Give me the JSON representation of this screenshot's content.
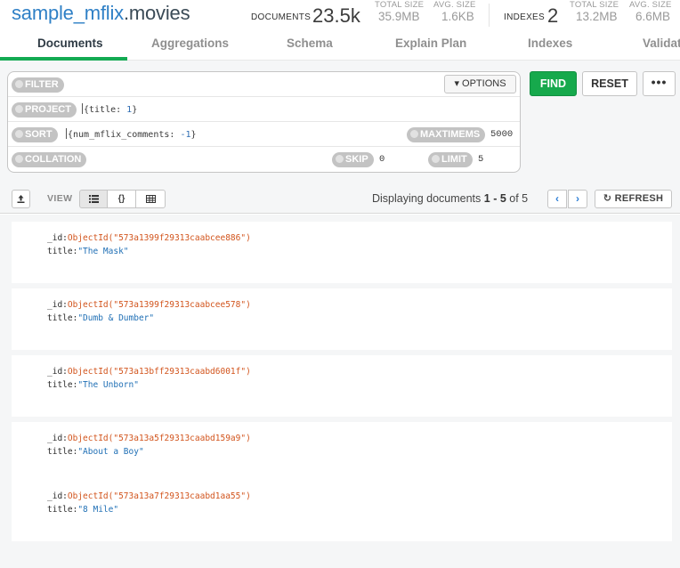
{
  "header": {
    "db": "sample_mflix",
    "collection": ".movies",
    "documents_label": "DOCUMENTS",
    "documents_count": "23.5k",
    "doc_total_size_label": "TOTAL SIZE",
    "doc_total_size": "35.9MB",
    "doc_avg_size_label": "AVG. SIZE",
    "doc_avg_size": "1.6KB",
    "indexes_label": "INDEXES",
    "indexes_count": "2",
    "idx_total_size_label": "TOTAL SIZE",
    "idx_total_size": "13.2MB",
    "idx_avg_size_label": "AVG. SIZE",
    "idx_avg_size": "6.6MB"
  },
  "tabs": [
    {
      "label": "Documents",
      "active": true
    },
    {
      "label": "Aggregations"
    },
    {
      "label": "Schema"
    },
    {
      "label": "Explain Plan"
    },
    {
      "label": "Indexes"
    },
    {
      "label": "Validat"
    }
  ],
  "query": {
    "filter_label": "FILTER",
    "options_label": "▾ OPTIONS",
    "project_label": "PROJECT",
    "project_key": "{title: ",
    "project_num": "1",
    "project_close": "}",
    "sort_label": "SORT",
    "sort_key": "{num_mflix_comments: ",
    "sort_num": "-1",
    "sort_close": "}",
    "maxtimems_label": "MAXTIMEMS",
    "maxtimems_value": "5000",
    "collation_label": "COLLATION",
    "skip_label": "SKIP",
    "skip_value": "0",
    "limit_label": "LIMIT",
    "limit_value": "5",
    "find_label": "FIND",
    "reset_label": "RESET",
    "more_label": "•••"
  },
  "toolbar": {
    "view_label": "VIEW",
    "displaying_prefix": "Displaying documents ",
    "range": "1 - 5",
    "of_text": " of ",
    "total": "5",
    "refresh_label": "REFRESH"
  },
  "documents": [
    {
      "id_key": "_id:",
      "id": "ObjectId(\"573a1399f29313caabcee886\")",
      "title_key": "title:",
      "title": "\"The Mask\""
    },
    {
      "id_key": "_id:",
      "id": "ObjectId(\"573a1399f29313caabcee578\")",
      "title_key": "title:",
      "title": "\"Dumb & Dumber\""
    },
    {
      "id_key": "_id:",
      "id": "ObjectId(\"573a13bff29313caabd6001f\")",
      "title_key": "title:",
      "title": "\"The Unborn\""
    },
    {
      "id_key": "_id:",
      "id": "ObjectId(\"573a13a5f29313caabd159a9\")",
      "title_key": "title:",
      "title": "\"About a Boy\""
    },
    {
      "id_key": "_id:",
      "id": "ObjectId(\"573a13a7f29313caabd1aa55\")",
      "title_key": "title:",
      "title": "\"8 Mile\""
    }
  ]
}
